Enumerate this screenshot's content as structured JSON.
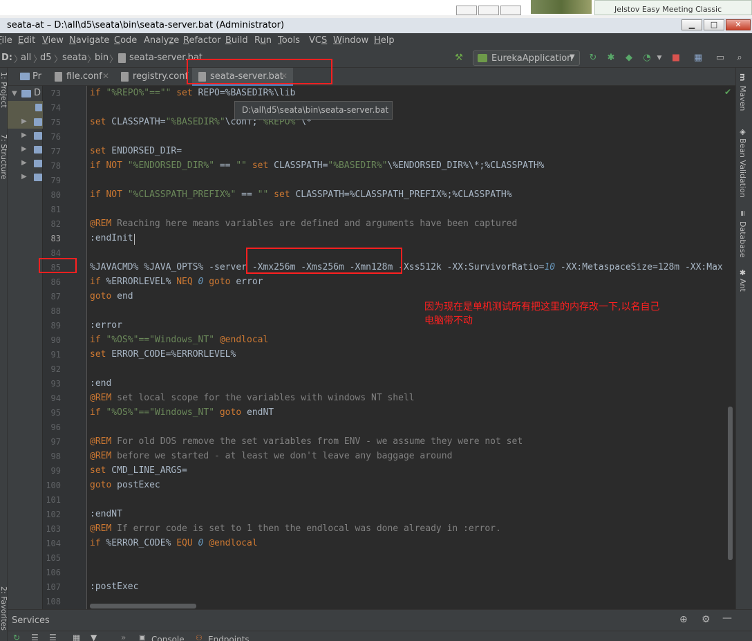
{
  "window": {
    "title": "seata-at – D:\\all\\d5\\seata\\bin\\seata-server.bat (Administrator)",
    "other_task_title": "Jelstov Easy Meeting Classic",
    "minimize": "▁",
    "maximize": "□",
    "close": "✕"
  },
  "menu": {
    "items": [
      {
        "prefix": "",
        "u": "F",
        "rest": "ile"
      },
      {
        "prefix": "",
        "u": "E",
        "rest": "dit"
      },
      {
        "prefix": "",
        "u": "V",
        "rest": "iew"
      },
      {
        "prefix": "",
        "u": "N",
        "rest": "avigate"
      },
      {
        "prefix": "",
        "u": "C",
        "rest": "ode"
      },
      {
        "prefix": "Analy",
        "u": "z",
        "rest": "e"
      },
      {
        "prefix": "",
        "u": "R",
        "rest": "efactor"
      },
      {
        "prefix": "",
        "u": "B",
        "rest": "uild"
      },
      {
        "prefix": "R",
        "u": "u",
        "rest": "n"
      },
      {
        "prefix": "",
        "u": "T",
        "rest": "ools"
      },
      {
        "prefix": "VC",
        "u": "S",
        "rest": ""
      },
      {
        "prefix": "",
        "u": "W",
        "rest": "indow"
      },
      {
        "prefix": "",
        "u": "H",
        "rest": "elp"
      }
    ]
  },
  "navbar": {
    "crumbs": [
      "D:",
      "all",
      "d5",
      "seata",
      "bin",
      "seata-server.bat"
    ],
    "run_config": "EurekaApplication"
  },
  "project_panel": {
    "label": "Pr",
    "root": "D"
  },
  "left_strip": {
    "project": "1: Project",
    "structure": "7: Structure",
    "favorites": "2: Favorites"
  },
  "tabs": [
    {
      "label": "file.conf",
      "active": false
    },
    {
      "label": "registry.conf",
      "active": false
    },
    {
      "label": "seata-server.bat",
      "active": true
    }
  ],
  "tooltip": "D:\\all\\d5\\seata\\bin\\seata-server.bat",
  "editor": {
    "current_line": 83,
    "lines": [
      {
        "n": 73,
        "html": "<span class=\"t-kw\">if</span> <span class=\"t-str\">\"%REPO%\"==\"\"</span> <span class=\"t-kw\">set</span> REPO=%BASEDIR%\\lib"
      },
      {
        "n": 74,
        "html": ""
      },
      {
        "n": 75,
        "html": "<span class=\"t-kw\">set</span> CLASSPATH=<span class=\"t-str\">\"%BASEDIR%\"</span>\\conf;<span class=\"t-str\">\"%REPO%\"</span>\\*"
      },
      {
        "n": 76,
        "html": ""
      },
      {
        "n": 77,
        "html": "<span class=\"t-kw\">set</span> ENDORSED_DIR="
      },
      {
        "n": 78,
        "html": "<span class=\"t-kw\">if NOT</span> <span class=\"t-str\">\"%ENDORSED_DIR%\"</span> == <span class=\"t-str\">\"\"</span> <span class=\"t-kw\">set</span> CLASSPATH=<span class=\"t-str\">\"%BASEDIR%\"</span>\\%ENDORSED_DIR%\\*;%CLASSPATH%"
      },
      {
        "n": 79,
        "html": ""
      },
      {
        "n": 80,
        "html": "<span class=\"t-kw\">if NOT</span> <span class=\"t-str\">\"%CLASSPATH_PREFIX%\"</span> == <span class=\"t-str\">\"\"</span> <span class=\"t-kw\">set</span> CLASSPATH=%CLASSPATH_PREFIX%;%CLASSPATH%"
      },
      {
        "n": 81,
        "html": ""
      },
      {
        "n": 82,
        "html": "<span class=\"t-kw\">@REM</span> <span class=\"t-com\">Reaching here means variables are defined and arguments have been captured</span>"
      },
      {
        "n": 83,
        "html": ":endInit"
      },
      {
        "n": 84,
        "html": ""
      },
      {
        "n": 85,
        "html": "%JAVACMD% %JAVA_OPTS% -server -Xmx256m -Xms256m -Xmn128m -Xss512k -XX:SurvivorRatio=<span class=\"t-num\">10</span> -XX:MetaspaceSize=128m -XX:Max"
      },
      {
        "n": 86,
        "html": "<span class=\"t-kw\">if</span> %ERRORLEVEL% <span class=\"t-kw\">NEQ</span> <span class=\"t-num\">0</span> <span class=\"t-kw\">goto</span> error"
      },
      {
        "n": 87,
        "html": "<span class=\"t-kw\">goto</span> end"
      },
      {
        "n": 88,
        "html": ""
      },
      {
        "n": 89,
        "html": ":error"
      },
      {
        "n": 90,
        "html": "<span class=\"t-kw\">if</span> <span class=\"t-str\">\"%OS%\"==\"Windows_NT\"</span> <span class=\"t-kw\">@endlocal</span>"
      },
      {
        "n": 91,
        "html": "<span class=\"t-kw\">set</span> ERROR_CODE=%ERRORLEVEL%"
      },
      {
        "n": 92,
        "html": ""
      },
      {
        "n": 93,
        "html": ":end"
      },
      {
        "n": 94,
        "html": "<span class=\"t-kw\">@REM</span> <span class=\"t-com\">set local scope for the variables with windows NT shell</span>"
      },
      {
        "n": 95,
        "html": "<span class=\"t-kw\">if</span> <span class=\"t-str\">\"%OS%\"==\"Windows_NT\"</span> <span class=\"t-kw\">goto</span> endNT"
      },
      {
        "n": 96,
        "html": ""
      },
      {
        "n": 97,
        "html": "<span class=\"t-kw\">@REM</span> <span class=\"t-com\">For old DOS remove the set variables from ENV - we assume they were not set</span>"
      },
      {
        "n": 98,
        "html": "<span class=\"t-kw\">@REM</span> <span class=\"t-com\">before we started - at least we don't leave any baggage around</span>"
      },
      {
        "n": 99,
        "html": "<span class=\"t-kw\">set</span> CMD_LINE_ARGS="
      },
      {
        "n": 100,
        "html": "<span class=\"t-kw\">goto</span> postExec"
      },
      {
        "n": 101,
        "html": ""
      },
      {
        "n": 102,
        "html": ":endNT"
      },
      {
        "n": 103,
        "html": "<span class=\"t-kw\">@REM</span> <span class=\"t-com\">If error code is set to 1 then the endlocal was done already in :error.</span>"
      },
      {
        "n": 104,
        "html": "<span class=\"t-kw\">if</span> %ERROR_CODE% <span class=\"t-kw\">EQU</span> <span class=\"t-num\">0</span> <span class=\"t-kw\">@endlocal</span>"
      },
      {
        "n": 105,
        "html": ""
      },
      {
        "n": 106,
        "html": ""
      },
      {
        "n": 107,
        "html": ":postExec"
      },
      {
        "n": 108,
        "html": ""
      }
    ]
  },
  "annotation": {
    "line1": "因为现在是单机测试所有把这里的内存改一下,以名自己",
    "line2": "电脑带不动"
  },
  "right_strip": {
    "maven": "Maven",
    "bean": "Bean Validation",
    "database": "Database",
    "ant": "Ant"
  },
  "services": {
    "title": "Services",
    "console": "Console",
    "endpoints": "Endpoints"
  },
  "colors": {
    "accent": "#4a88c7",
    "annotation": "#ff2020",
    "editor_bg": "#2b2b2b"
  }
}
